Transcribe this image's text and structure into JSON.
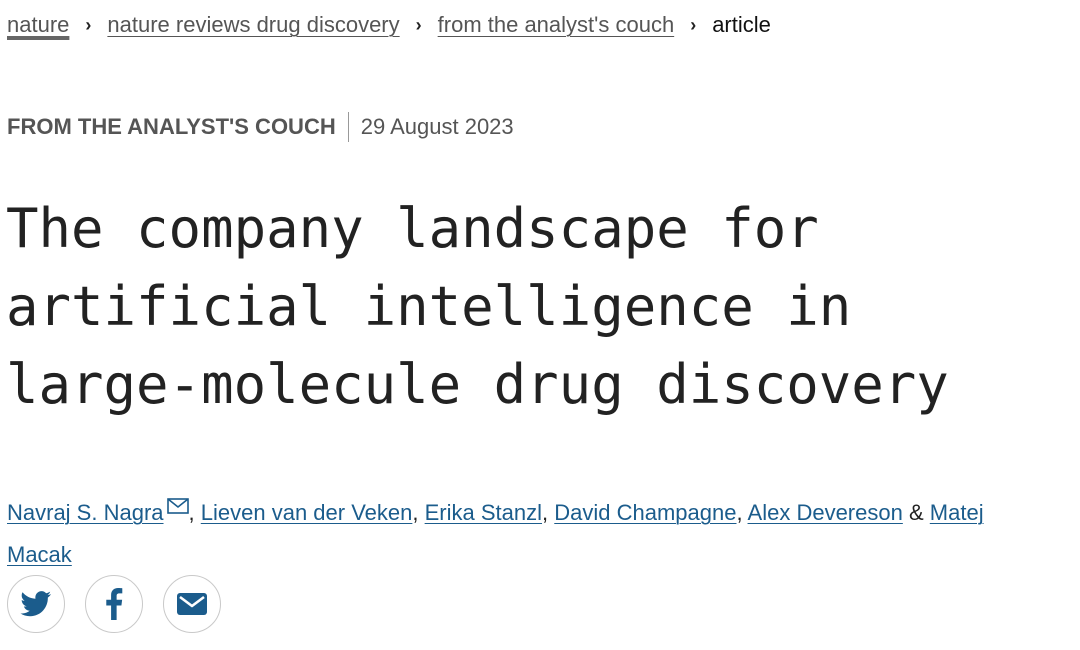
{
  "breadcrumb": {
    "items": [
      {
        "label": "nature"
      },
      {
        "label": "nature reviews drug discovery"
      },
      {
        "label": "from the analyst's couch"
      }
    ],
    "current": "article",
    "separator": "›"
  },
  "article": {
    "type": "FROM THE ANALYST'S COUCH",
    "date": "29 August 2023",
    "title": "The company landscape for artificial intelligence in large-molecule drug discovery"
  },
  "authors": {
    "list": [
      {
        "name": "Navraj S. Nagra",
        "corresponding_icon": "mail-icon"
      },
      {
        "name": "Lieven van der Veken"
      },
      {
        "name": "Erika Stanzl"
      },
      {
        "name": "David Champagne"
      },
      {
        "name": "Alex Devereson"
      },
      {
        "name": "Matej Macak"
      }
    ],
    "comma": ",",
    "conjunction": "&"
  },
  "share": {
    "buttons": [
      {
        "icon": "twitter-icon"
      },
      {
        "icon": "facebook-icon"
      },
      {
        "icon": "email-icon"
      }
    ]
  },
  "colors": {
    "link": "#1b5c8c",
    "icon": "#1b5c8c",
    "muted_text": "#555555"
  }
}
